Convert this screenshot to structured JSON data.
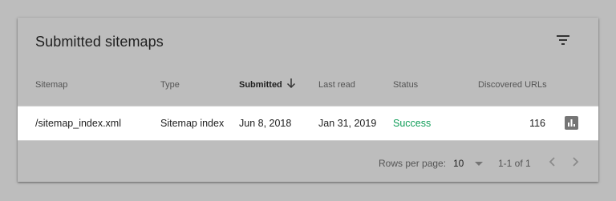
{
  "card": {
    "title": "Submitted sitemaps"
  },
  "table": {
    "headers": {
      "sitemap": "Sitemap",
      "type": "Type",
      "submitted": "Submitted",
      "last_read": "Last read",
      "status": "Status",
      "discovered_urls": "Discovered URLs"
    },
    "rows": [
      {
        "sitemap": "/sitemap_index.xml",
        "type": "Sitemap index",
        "submitted": "Jun 8, 2018",
        "last_read": "Jan 31, 2019",
        "status": "Success",
        "discovered_urls": "116"
      }
    ]
  },
  "footer": {
    "rows_per_page_label": "Rows per page:",
    "rows_per_page_value": "10",
    "range": "1-1 of 1"
  },
  "icons": {
    "filter": "filter-icon",
    "sort": "arrow-down-icon",
    "chart": "bar-chart-icon",
    "prev": "chevron-left-icon",
    "next": "chevron-right-icon"
  },
  "colors": {
    "background": "#bdbdbd",
    "row_background": "#ffffff",
    "status_success": "#0f9d58"
  }
}
